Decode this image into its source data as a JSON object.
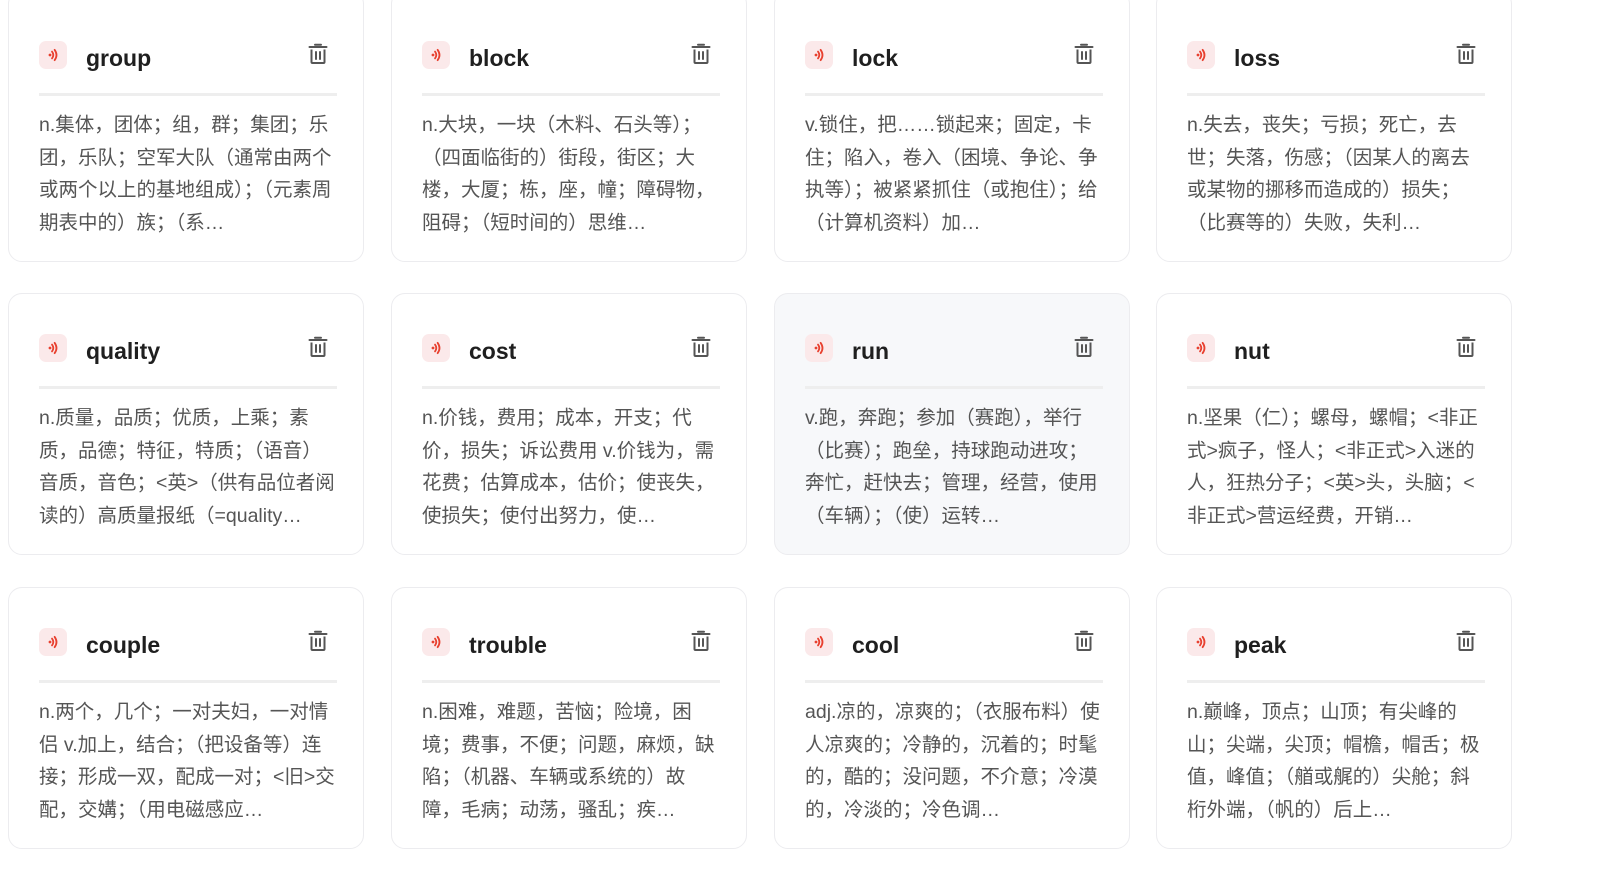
{
  "colors": {
    "sound_icon": "#e8402f",
    "sound_bg": "#fbe9ea",
    "word": "#1f1f1f",
    "definition": "#555555",
    "delete_icon": "#555555"
  },
  "icons": {
    "sound": "speaker-sound-icon",
    "delete": "trash-icon"
  },
  "words": [
    {
      "word": "group",
      "definition": "n.集体，团体；组，群；集团；乐团，乐队；空军大队（通常由两个或两个以上的基地组成）；（元素周期表中的）族；（系…",
      "hovered": false
    },
    {
      "word": "block",
      "definition": "n.大块，一块（木料、石头等）；（四面临街的）街段，街区；大楼，大厦；栋，座，幢；障碍物，阻碍；（短时间的）思维…",
      "hovered": false
    },
    {
      "word": "lock",
      "definition": "v.锁住，把……锁起来；固定，卡住；陷入，卷入（困境、争论、争执等）；被紧紧抓住（或抱住）；给（计算机资料）加…",
      "hovered": false
    },
    {
      "word": "loss",
      "definition": "n.失去，丧失；亏损；死亡，去世；失落，伤感；（因某人的离去或某物的挪移而造成的）损失；（比赛等的）失败，失利…",
      "hovered": false
    },
    {
      "word": "quality",
      "definition": "n.质量，品质；优质，上乘；素质，品德；特征，特质；（语音）音质，音色；<英>（供有品位者阅读的）高质量报纸（=quality…",
      "hovered": false
    },
    {
      "word": "cost",
      "definition": "n.价钱，费用；成本，开支；代价，损失；诉讼费用 v.价钱为，需花费；估算成本，估价；使丧失，使损失；使付出努力，使…",
      "hovered": false
    },
    {
      "word": "run",
      "definition": "v.跑，奔跑；参加（赛跑），举行（比赛）；跑垒，持球跑动进攻；奔忙，赶快去；管理，经营，使用（车辆）；（使）运转…",
      "hovered": true
    },
    {
      "word": "nut",
      "definition": "n.坚果（仁）；螺母，螺帽；<非正式>疯子，怪人；<非正式>入迷的人，狂热分子；<英>头，头脑；<非正式>营运经费，开销…",
      "hovered": false
    },
    {
      "word": "couple",
      "definition": "n.两个，几个；一对夫妇，一对情侣 v.加上，结合；（把设备等）连接；形成一双，配成一对；<旧>交配，交媾；（用电磁感应…",
      "hovered": false
    },
    {
      "word": "trouble",
      "definition": "n.困难，难题，苦恼；险境，困境；费事，不便；问题，麻烦，缺陷；（机器、车辆或系统的）故障，毛病；动荡，骚乱；疾…",
      "hovered": false
    },
    {
      "word": "cool",
      "definition": "adj.凉的，凉爽的；（衣服布料）使人凉爽的；冷静的，沉着的；时髦的，酷的；没问题，不介意；冷漠的，冷淡的；冷色调…",
      "hovered": false
    },
    {
      "word": "peak",
      "definition": "n.巅峰，顶点；山顶；有尖峰的山；尖端，尖顶；帽檐，帽舌；极值，峰值；（艏或艉的）尖舱；斜桁外端，（帆的）后上…",
      "hovered": false
    }
  ]
}
